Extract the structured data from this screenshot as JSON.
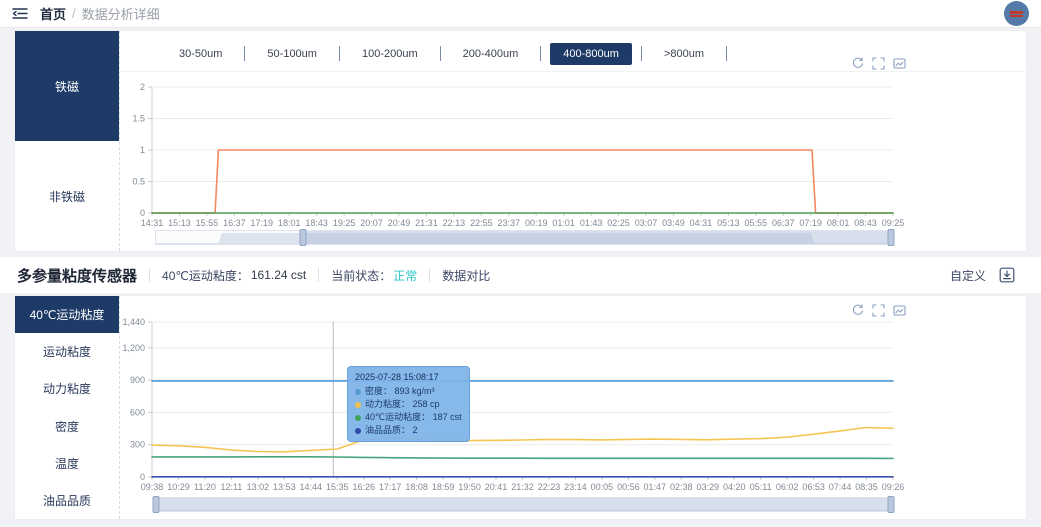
{
  "header": {
    "breadcrumb": {
      "home": "首页",
      "separator": "/",
      "current": "数据分析详细"
    }
  },
  "colors": {
    "accent_navy": "#1e3a66",
    "status_ok": "#2fc5c9"
  },
  "toolbox_icons": [
    "restore-icon",
    "zoom-select-icon",
    "save-image-icon"
  ],
  "panel1": {
    "sidebar": [
      {
        "label": "铁磁",
        "active": true
      },
      {
        "label": "非铁磁",
        "active": false
      }
    ],
    "tabs": [
      {
        "label": "30-50um",
        "active": false
      },
      {
        "label": "50-100um",
        "active": false
      },
      {
        "label": "100-200um",
        "active": false
      },
      {
        "label": "200-400um",
        "active": false
      },
      {
        "label": "400-800um",
        "active": true
      },
      {
        "label": ">800um",
        "active": false
      }
    ]
  },
  "section2": {
    "title": "多参量粘度传感器",
    "metric_label": "40℃运动粘度：",
    "metric_value": "161.24 cst",
    "status_label": "当前状态：",
    "status_value": "正常",
    "compare_label": "数据对比",
    "custom_label": "自定义"
  },
  "panel2": {
    "sidebar": [
      {
        "label": "40℃运动粘度",
        "active": true
      },
      {
        "label": "运动粘度",
        "active": false
      },
      {
        "label": "动力粘度",
        "active": false
      },
      {
        "label": "密度",
        "active": false
      },
      {
        "label": "温度",
        "active": false
      },
      {
        "label": "油品品质",
        "active": false
      }
    ]
  },
  "chart_data": [
    {
      "type": "line",
      "title": "",
      "x_labels": [
        "14:31",
        "15:13",
        "15:55",
        "16:37",
        "17:19",
        "18:01",
        "18:43",
        "19:25",
        "20:07",
        "20:49",
        "21:31",
        "22:13",
        "22:55",
        "23:37",
        "00:19",
        "01:01",
        "01:43",
        "02:25",
        "03:07",
        "03:49",
        "04:31",
        "05:13",
        "05:55",
        "06:37",
        "07:19",
        "08:01",
        "08:43",
        "09:25"
      ],
      "ylim": [
        0,
        2
      ],
      "yticks": [
        0,
        0.5,
        1,
        1.5,
        2
      ],
      "ytick_labels": [
        "0",
        "0.5",
        "1",
        "1.5",
        "2"
      ],
      "grid": true,
      "series": [
        {
          "name": "",
          "color": "#f4875f",
          "points": [
            [
              0,
              0
            ],
            [
              2.3,
              0
            ],
            [
              2.42,
              1
            ],
            [
              24.05,
              1
            ],
            [
              24.18,
              0
            ],
            [
              27,
              0
            ]
          ]
        },
        {
          "name": "",
          "color": "#4b9e51",
          "points": [
            [
              0,
              0
            ],
            [
              27,
              0
            ]
          ]
        }
      ],
      "datazoom": {
        "start_pct": 20,
        "end_pct": 100
      }
    },
    {
      "type": "line",
      "title": "",
      "x_labels": [
        "09:38",
        "10:29",
        "11:20",
        "12:11",
        "13:02",
        "13:53",
        "14:44",
        "15:35",
        "16:26",
        "17:17",
        "18:08",
        "18:59",
        "19:50",
        "20:41",
        "21:32",
        "22:23",
        "23:14",
        "00:05",
        "00:56",
        "01:47",
        "02:38",
        "03:29",
        "04:20",
        "05:11",
        "06:02",
        "06:53",
        "07:44",
        "08:35",
        "09:26"
      ],
      "ylim": [
        0,
        1440
      ],
      "yticks": [
        0,
        300,
        600,
        900,
        1200,
        1440
      ],
      "ytick_labels": [
        "0",
        "300",
        "600",
        "900",
        "1,200",
        "1,440"
      ],
      "grid": true,
      "crosshair_index": 6.85,
      "series": [
        {
          "name": "密度",
          "color": "#4e97d9",
          "values": [
            893,
            893,
            893,
            893,
            893,
            893,
            893,
            893,
            893,
            893,
            893,
            893,
            893,
            893,
            893,
            893,
            893,
            893,
            893,
            893,
            893,
            893,
            893,
            893,
            893,
            893,
            893,
            893,
            893
          ]
        },
        {
          "name": "动力粘度",
          "color": "#f5c554",
          "values": [
            296,
            290,
            276,
            250,
            237,
            234,
            247,
            260,
            345,
            365,
            350,
            340,
            338,
            341,
            344,
            349,
            347,
            345,
            349,
            352,
            349,
            346,
            352,
            357,
            370,
            398,
            428,
            460,
            452
          ]
        },
        {
          "name": "40℃运动粘度",
          "color": "#45a47b",
          "values": [
            187,
            187,
            187,
            187,
            188,
            188,
            188,
            186,
            182,
            179,
            177,
            176,
            175,
            175,
            175,
            174,
            174,
            174,
            174,
            174,
            174,
            174,
            174,
            174,
            174,
            174,
            174,
            174,
            173
          ]
        },
        {
          "name": "油品品质",
          "color": "#3d4eae",
          "values": [
            2,
            2,
            2,
            2,
            2,
            2,
            2,
            2,
            2,
            2,
            2,
            2,
            2,
            2,
            2,
            2,
            2,
            2,
            2,
            2,
            2,
            2,
            2,
            2,
            2,
            2,
            2,
            2,
            2
          ]
        }
      ],
      "tooltip": {
        "title": "2025-07-28 15:08:17",
        "items": [
          {
            "marker_color": "#5b9bd5",
            "label": "密度：",
            "value": "893 kg/m³"
          },
          {
            "marker_color": "#f2c14e",
            "label": "动力粘度：",
            "value": "258 cp"
          },
          {
            "marker_color": "#3fa45b",
            "label": "40℃运动粘度：",
            "value": "187 cst"
          },
          {
            "marker_color": "#2f4aa8",
            "label": "油品品质：",
            "value": "2"
          }
        ]
      },
      "datazoom": {
        "start_pct": 0,
        "end_pct": 100
      }
    }
  ]
}
